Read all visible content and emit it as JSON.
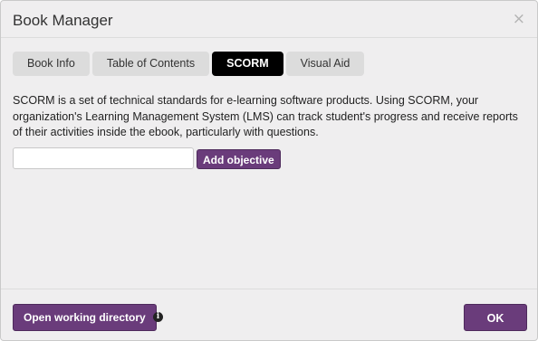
{
  "dialog": {
    "title": "Book Manager",
    "close_icon": "close-icon",
    "close_glyph": "×"
  },
  "tabs": [
    {
      "label": "Book Info",
      "active": false
    },
    {
      "label": "Table of Contents",
      "active": false
    },
    {
      "label": "SCORM",
      "active": true
    },
    {
      "label": "Visual Aid",
      "active": false
    }
  ],
  "scorm": {
    "description": "SCORM is a set of technical standards for e-learning software products. Using SCORM, your organization's Learning Management System (LMS) can track student's progress and receive reports of their activities inside the ebook, particularly with questions.",
    "objective_input_value": "",
    "add_objective_label": "Add objective"
  },
  "footer": {
    "open_working_directory_label": "Open working directory",
    "info_icon": "info-icon",
    "info_glyph": "i",
    "ok_label": "OK"
  },
  "colors": {
    "accent": "#6a3c7b",
    "active_tab": "#000000",
    "dialog_bg": "#efeeef"
  }
}
